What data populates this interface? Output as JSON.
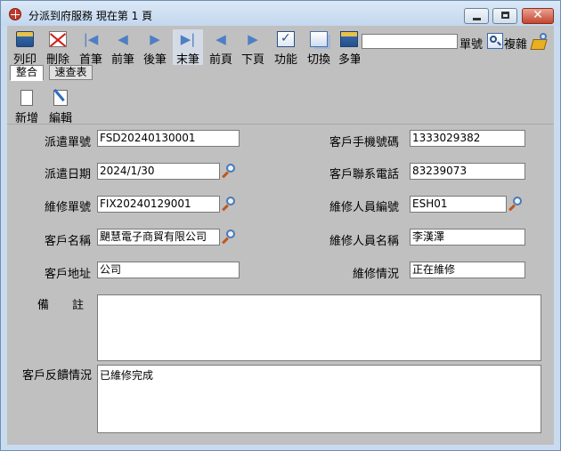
{
  "window": {
    "title": "分派到府服務  現在第 1 頁",
    "close_glyph": "✕"
  },
  "toolbar": {
    "items": [
      {
        "label": "列印",
        "icon": "printer-icon"
      },
      {
        "label": "刪除",
        "icon": "delete-icon"
      },
      {
        "label": "首筆",
        "icon": "first-record-icon"
      },
      {
        "label": "前筆",
        "icon": "previous-record-icon"
      },
      {
        "label": "後筆",
        "icon": "next-record-icon"
      },
      {
        "label": "末筆",
        "icon": "last-record-icon"
      },
      {
        "label": "前頁",
        "icon": "previous-page-icon"
      },
      {
        "label": "下頁",
        "icon": "next-page-icon"
      },
      {
        "label": "功能",
        "icon": "function-icon"
      },
      {
        "label": "切換",
        "icon": "switch-icon"
      },
      {
        "label": "多筆",
        "icon": "multi-record-icon"
      }
    ],
    "arrows": {
      "first": "|◀",
      "prev": "◀",
      "next": "▶",
      "last": "▶|",
      "page_prev": "◀",
      "page_next": "▶"
    },
    "search_value": "",
    "search_label": "單號",
    "copy_label": "複雜"
  },
  "tabs": [
    {
      "label": "整合",
      "active": true
    },
    {
      "label": "速查表",
      "active": false
    }
  ],
  "actions": {
    "new_label": "新增",
    "edit_label": "編輯"
  },
  "form": {
    "dispatch_no": {
      "label": "派遣單號",
      "value": "FSD20240130001"
    },
    "dispatch_date": {
      "label": "派遣日期",
      "value": "2024/1/30"
    },
    "repair_no": {
      "label": "維修單號",
      "value": "FIX20240129001"
    },
    "customer_name": {
      "label": "客戶名稱",
      "value": "颶慧電子商貿有限公司"
    },
    "customer_address": {
      "label": "客戶地址",
      "value": "公司"
    },
    "customer_mobile": {
      "label": "客戶手機號碼",
      "value": "1333029382"
    },
    "customer_phone": {
      "label": "客戶聯系電話",
      "value": "83239073"
    },
    "technician_id": {
      "label": "維修人員編號",
      "value": "ESH01"
    },
    "technician_name": {
      "label": "維修人員名稱",
      "value": "李漢澤"
    },
    "repair_status": {
      "label": "維修情況",
      "value": "正在維修"
    },
    "remarks": {
      "label": "備　　註",
      "value": ""
    },
    "feedback": {
      "label": "客戶反饋情況",
      "value": "已維修完成"
    }
  }
}
